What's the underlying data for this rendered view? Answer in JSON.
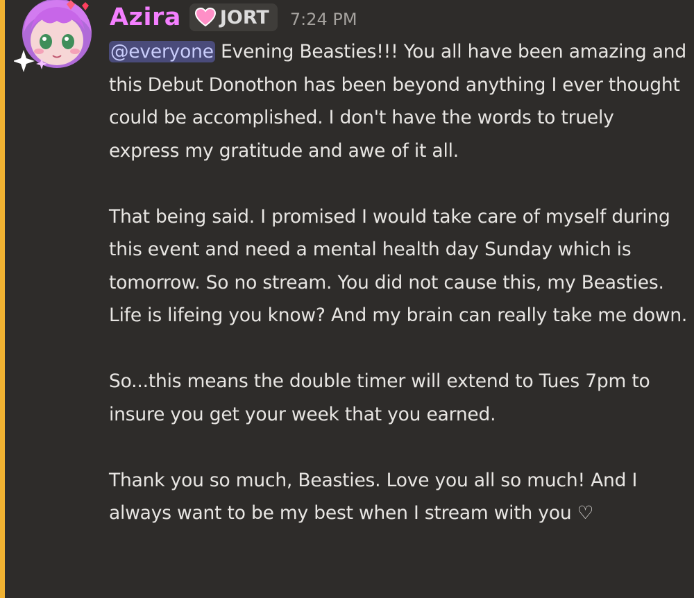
{
  "message": {
    "author": "Azira",
    "tag": "JORT",
    "tag_icon": "pink-heart-icon",
    "timestamp": "7:24 PM",
    "mention": "@everyone",
    "para1_rest": " Evening Beasties!!! You all have been amazing and this Debut Donothon has been beyond anything I ever thought could be accomplished. I don't have the words to truely express my gratitude and awe of it all.",
    "para2": "That being said. I promised I would take care of myself during this event and need a mental health day Sunday which is tomorrow. So no stream. You did not cause this, my Beasties. Life is lifeing you know? And my brain can really take me down.",
    "para3": "So...this means the double timer will extend to Tues 7pm to insure you get your week that you earned.",
    "para4": "Thank you so much, Beasties. Love you all so much! And I always want to be my best when I stream with you ♡"
  },
  "colors": {
    "background": "#2e2c2a",
    "mention_bar": "#f0b232",
    "username": "#f47fff",
    "mention_bg": "#4a4b7a",
    "mention_text": "#c9cdfb",
    "text": "#e8e6e3",
    "timestamp": "#a5a29e"
  }
}
